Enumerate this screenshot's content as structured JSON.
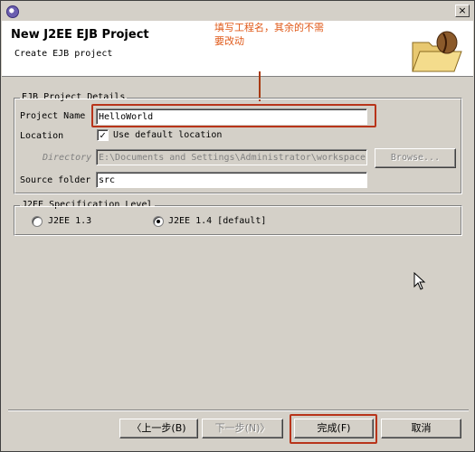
{
  "window": {
    "close_glyph": "×"
  },
  "header": {
    "title": "New J2EE EJB Project",
    "description": "Create EJB project",
    "annotation": "填写工程名，其余的不需要改动"
  },
  "details": {
    "legend": "EJB Project Details",
    "project_name_label": "Project Name",
    "project_name_value": "HelloWorld",
    "location_label": "Location",
    "use_default_checked": true,
    "use_default_label": "Use default location",
    "directory_label": "Directory",
    "directory_value": "E:\\Documents and Settings\\Administrator\\workspace",
    "browse_label": "Browse...",
    "source_folder_label": "Source folder",
    "source_folder_value": "src"
  },
  "spec": {
    "legend": "J2EE Specification Level",
    "options": [
      {
        "label": "J2EE 1.3",
        "selected": false
      },
      {
        "label": "J2EE 1.4 [default]",
        "selected": true
      }
    ]
  },
  "footer": {
    "back_label": "〈上一步(B)",
    "next_label": "下一步(N)〉",
    "finish_label": "完成(F)",
    "cancel_label": "取消"
  },
  "colors": {
    "annotation": "#e05a1a",
    "highlight": "#b8341a",
    "face": "#d4d0c8"
  },
  "icons": [
    "app-icon",
    "close-icon",
    "wizard-banner-icon",
    "checkmark-icon",
    "mouse-cursor-icon"
  ]
}
